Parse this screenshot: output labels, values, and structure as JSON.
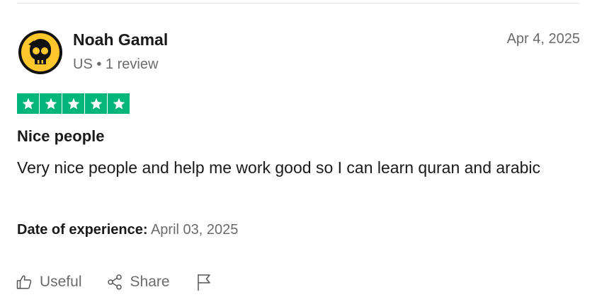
{
  "review": {
    "author": "Noah Gamal",
    "country": "US",
    "separator": "•",
    "review_count": "1 review",
    "posted_date": "Apr 4, 2025",
    "rating": 5,
    "rating_max": 5,
    "title": "Nice people",
    "text": "Very nice people and help me work good so I can learn quran and arabic",
    "experience_label": "Date of experience:",
    "experience_date": "April 03, 2025"
  },
  "actions": {
    "useful_label": "Useful",
    "share_label": "Share"
  },
  "icons": {
    "avatar": "brawl-skull-avatar",
    "useful": "thumbs-up-icon",
    "share": "share-icon",
    "report": "flag-icon",
    "star": "star-icon"
  },
  "colors": {
    "star_green": "#00b67a",
    "avatar_yellow": "#ffc72c",
    "muted_text": "#6b6b6b"
  }
}
